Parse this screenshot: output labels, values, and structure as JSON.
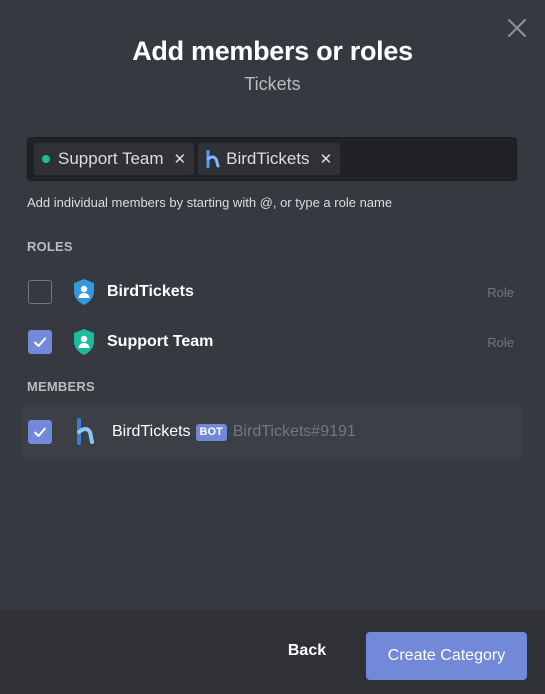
{
  "modal": {
    "title": "Add members or roles",
    "subtitle": "Tickets"
  },
  "search": {
    "chips": [
      {
        "label": "Support Team",
        "kind": "role",
        "color": "#1abc9c"
      },
      {
        "label": "BirdTickets",
        "kind": "bot"
      }
    ],
    "remove_glyph": "✕"
  },
  "helper_text": "Add individual members by starting with @, or type a role name",
  "roles_section": {
    "label": "ROLES",
    "items": [
      {
        "name": "BirdTickets",
        "type": "Role",
        "checked": false,
        "icon_color": "#3498db"
      },
      {
        "name": "Support Team",
        "type": "Role",
        "checked": true,
        "icon_color": "#1abc9c"
      }
    ]
  },
  "members_section": {
    "label": "MEMBERS",
    "items": [
      {
        "name": "BirdTickets",
        "badge": "BOT",
        "tag": "BirdTickets#9191",
        "checked": true
      }
    ]
  },
  "footer": {
    "back_label": "Back",
    "create_label": "Create Category"
  },
  "colors": {
    "accent": "#7289da",
    "background": "#36393f",
    "footer": "#2f3136"
  }
}
